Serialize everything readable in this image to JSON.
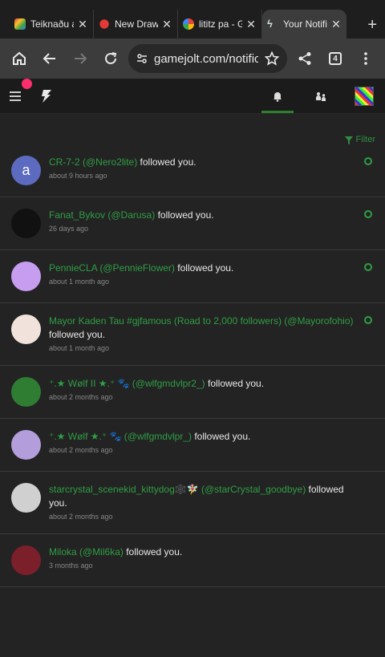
{
  "browser": {
    "tabs": [
      {
        "title": "Teiknaðu a",
        "fav": "#c84bdc",
        "active": false
      },
      {
        "title": "New Drawi",
        "fav": "#e53935",
        "active": false
      },
      {
        "title": "lititz pa - G",
        "fav": "#4285f4",
        "active": false
      },
      {
        "title": "Your Notific",
        "fav": "#cfd8dc",
        "active": true
      }
    ],
    "close_glyph": "✕",
    "new_tab_glyph": "+",
    "url": "gamejolt.com/notificat",
    "tab_count": "4"
  },
  "site": {
    "filter_label": "Filter"
  },
  "notifications": [
    {
      "name": "CR-7-2 (@Nero2lite)",
      "action": " followed you.",
      "time": "about 9 hours ago",
      "unread": true,
      "avatar_letter": "a",
      "avatar_color": "#5c6bc0"
    },
    {
      "name": "Fanat_Bykov (@Darusa)",
      "action": " followed you.",
      "time": "26 days ago",
      "unread": true,
      "avatar_letter": "",
      "avatar_color": "#111111"
    },
    {
      "name": "PennieCLA (@PennieFlower)",
      "action": " followed you.",
      "time": "about 1 month ago",
      "unread": true,
      "avatar_letter": "",
      "avatar_color": "#c79df0"
    },
    {
      "name": "Mayor Kaden Tau #gjfamous (Road to 2,000 followers) (@Mayorofohio)",
      "action": " followed you.",
      "time": "about 1 month ago",
      "unread": true,
      "avatar_letter": "",
      "avatar_color": "#f1e3dc"
    },
    {
      "name": "⁺.★ Wølf II ★.⁺ 🐾 (@wlfgmdvlpr2_)",
      "action": " followed you.",
      "time": "about 2 months ago",
      "unread": false,
      "avatar_letter": "",
      "avatar_color": "#2e7d32"
    },
    {
      "name": "⁺.★ Wølf ★.⁺ 🐾 (@wlfgmdvlpr_)",
      "action": " followed you.",
      "time": "about 2 months ago",
      "unread": false,
      "avatar_letter": "",
      "avatar_color": "#b39ddb"
    },
    {
      "name": "starcrystal_scenekid_kittydog🕸️🧚‍♀️ (@starCrystal_goodbye)",
      "action": " followed you.",
      "time": "about 2 months ago",
      "unread": false,
      "avatar_letter": "",
      "avatar_color": "#d0d0d0"
    },
    {
      "name": "Miloka (@Mil6ka)",
      "action": " followed you.",
      "time": "3 months ago",
      "unread": false,
      "avatar_letter": "",
      "avatar_color": "#7b1f2a"
    }
  ]
}
